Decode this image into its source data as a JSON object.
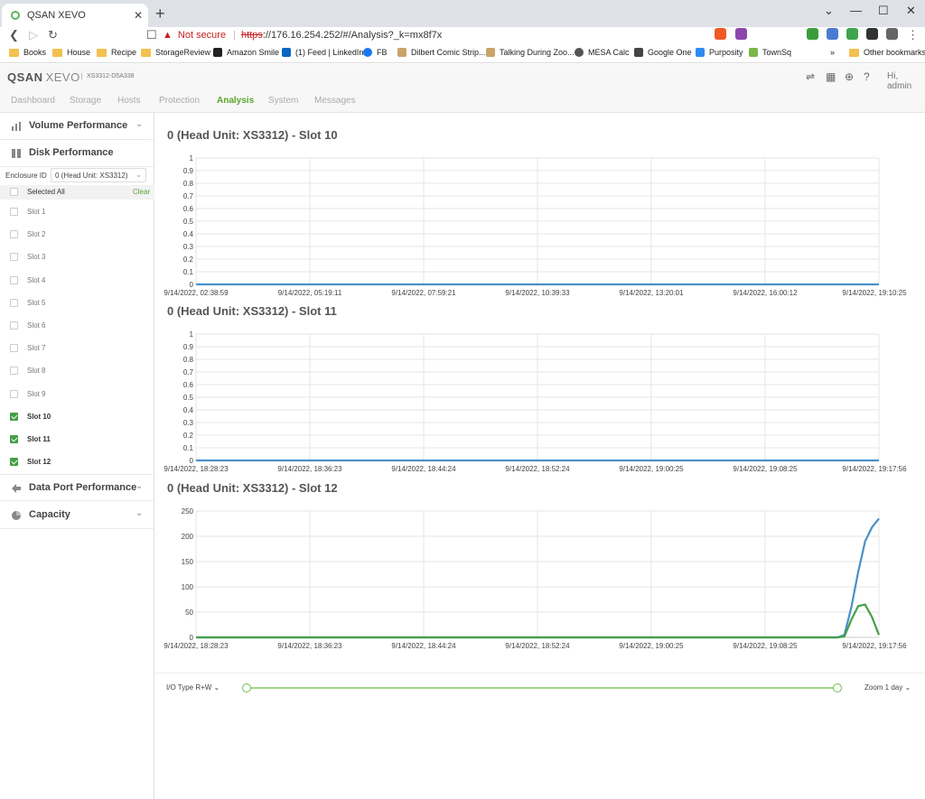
{
  "browser": {
    "tab_title": "QSAN XEVO",
    "security_label": "Not secure",
    "url_scheme": "https",
    "url_rest": "://176.16.254.252/#/Analysis?_k=mx8f7x",
    "bookmarks": [
      "Books",
      "House",
      "Recipe",
      "StorageReview",
      "Amazon Smile",
      "(1) Feed | LinkedIn",
      "FB",
      "Dilbert Comic Strip...",
      "Talking During Zoo...",
      "MESA Calc",
      "Google One",
      "Purposity",
      "TownSq"
    ],
    "other_bookmarks": "Other bookmarks"
  },
  "app": {
    "logo_q": "Q",
    "logo_san": "SAN",
    "logo_xevo": "XEVO",
    "serial": "XS3312-D5A338",
    "greeting": "Hi, admin",
    "tabs": [
      "Dashboard",
      "Storage",
      "Hosts",
      "Protection",
      "Analysis",
      "System",
      "Messages"
    ],
    "active_tab": "Analysis"
  },
  "sidebar": {
    "volume_performance": "Volume Performance",
    "disk_performance": "Disk Performance",
    "enclosure_label": "Enclosure ID",
    "enclosure_value": "0 (Head Unit: XS3312)",
    "selected_all": "Selected All",
    "clear": "Clear",
    "slots": [
      {
        "label": "Slot 1",
        "checked": false
      },
      {
        "label": "Slot 2",
        "checked": false
      },
      {
        "label": "Slot 3",
        "checked": false
      },
      {
        "label": "Slot 4",
        "checked": false
      },
      {
        "label": "Slot 5",
        "checked": false
      },
      {
        "label": "Slot 6",
        "checked": false
      },
      {
        "label": "Slot 7",
        "checked": false
      },
      {
        "label": "Slot 8",
        "checked": false
      },
      {
        "label": "Slot 9",
        "checked": false
      },
      {
        "label": "Slot 10",
        "checked": true
      },
      {
        "label": "Slot 11",
        "checked": true
      },
      {
        "label": "Slot 12",
        "checked": true
      }
    ],
    "data_port_performance": "Data Port Performance",
    "capacity": "Capacity"
  },
  "colors": {
    "accent_green": "#5aa52b",
    "series_blue": "#4a90c8",
    "series_green": "#43a047"
  },
  "chart_data": [
    {
      "type": "line",
      "title": "0 (Head Unit: XS3312) - Slot 10",
      "yticks": [
        "0",
        "0.1",
        "0.2",
        "0.3",
        "0.4",
        "0.5",
        "0.6",
        "0.7",
        "0.8",
        "0.9",
        "1"
      ],
      "ylim": [
        0,
        1
      ],
      "xticks": [
        "9/14/2022, 02:38:59",
        "9/14/2022, 05:19:11",
        "9/14/2022, 07:59:21",
        "9/14/2022, 10:39:33",
        "9/14/2022, 13:20:01",
        "9/14/2022, 16:00:12",
        "9/14/2022, 19:10:25"
      ],
      "series": [
        {
          "values": [
            0,
            0,
            0,
            0,
            0,
            0,
            0
          ]
        }
      ]
    },
    {
      "type": "line",
      "title": "0 (Head Unit: XS3312) - Slot 11",
      "yticks": [
        "0",
        "0.1",
        "0.2",
        "0.3",
        "0.4",
        "0.5",
        "0.6",
        "0.7",
        "0.8",
        "0.9",
        "1"
      ],
      "ylim": [
        0,
        1
      ],
      "xticks": [
        "9/14/2022, 18:28:23",
        "9/14/2022, 18:36:23",
        "9/14/2022, 18:44:24",
        "9/14/2022, 18:52:24",
        "9/14/2022, 19:00:25",
        "9/14/2022, 19:08:25",
        "9/14/2022, 19:17:56"
      ],
      "series": [
        {
          "values": [
            0,
            0,
            0,
            0,
            0,
            0,
            0
          ]
        }
      ]
    },
    {
      "type": "line",
      "title": "0 (Head Unit: XS3312) - Slot 12",
      "yticks": [
        "0",
        "50",
        "100",
        "150",
        "200",
        "250"
      ],
      "ylim": [
        0,
        250
      ],
      "xticks": [
        "9/14/2022, 18:28:23",
        "9/14/2022, 18:36:23",
        "9/14/2022, 18:44:24",
        "9/14/2022, 18:52:24",
        "9/14/2022, 19:00:25",
        "9/14/2022, 19:08:25",
        "9/14/2022, 19:17:56"
      ],
      "series": [
        {
          "values": [
            0,
            0,
            0,
            0,
            0,
            0,
            0,
            0,
            0,
            0,
            0,
            0,
            0,
            0,
            0,
            0,
            0,
            0,
            0,
            0,
            0,
            0,
            0,
            0,
            0,
            0,
            0,
            0,
            0,
            0,
            0,
            0,
            0,
            0,
            0,
            0,
            0,
            0,
            0,
            0,
            0,
            0,
            0,
            0,
            0,
            0,
            0,
            0,
            0,
            0,
            0,
            0,
            0,
            0,
            0,
            0,
            0,
            0,
            0,
            0,
            0,
            0,
            0,
            0,
            0,
            0,
            0,
            0,
            0,
            0,
            0,
            0,
            0,
            0,
            0,
            0,
            0,
            0,
            0,
            0,
            0,
            0,
            0,
            0,
            0,
            0,
            0,
            0,
            0,
            0,
            0,
            0,
            0,
            0,
            5,
            60,
            130,
            190,
            218,
            235
          ]
        },
        {
          "values": [
            0,
            0,
            0,
            0,
            0,
            0,
            0,
            0,
            0,
            0,
            0,
            0,
            0,
            0,
            0,
            0,
            0,
            0,
            0,
            0,
            0,
            0,
            0,
            0,
            0,
            0,
            0,
            0,
            0,
            0,
            0,
            0,
            0,
            0,
            0,
            0,
            0,
            0,
            0,
            0,
            0,
            0,
            0,
            0,
            0,
            0,
            0,
            0,
            0,
            0,
            0,
            0,
            0,
            0,
            0,
            0,
            0,
            0,
            0,
            0,
            0,
            0,
            0,
            0,
            0,
            0,
            0,
            0,
            0,
            0,
            0,
            0,
            0,
            0,
            0,
            0,
            0,
            0,
            0,
            0,
            0,
            0,
            0,
            0,
            0,
            0,
            0,
            0,
            0,
            0,
            0,
            0,
            0,
            0,
            2,
            35,
            62,
            65,
            40,
            5
          ]
        }
      ]
    }
  ],
  "bottom": {
    "io_type": "I/O Type R+W",
    "zoom": "Zoom 1 day"
  }
}
